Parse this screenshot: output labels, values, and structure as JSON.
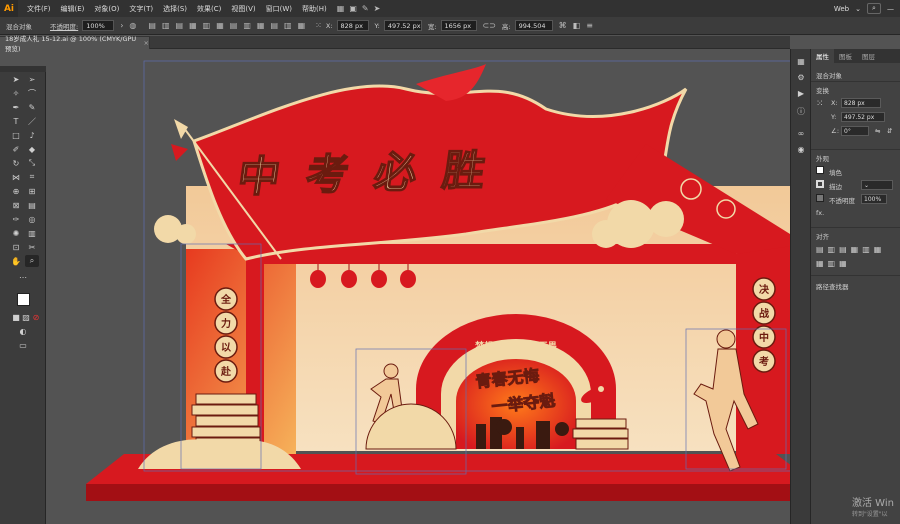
{
  "app": {
    "logo": "Ai"
  },
  "menubar": {
    "items": [
      "文件(F)",
      "编辑(E)",
      "对象(O)",
      "文字(T)",
      "选择(S)",
      "效果(C)",
      "视图(V)",
      "窗口(W)",
      "帮助(H)"
    ],
    "workspace": "Web"
  },
  "controlbar": {
    "selection_label": "混合对象",
    "opacity_label": "不透明度:",
    "opacity_value": "100%",
    "x_label": "X:",
    "x_value": "828 px",
    "y_label": "Y:",
    "y_value": "497.52 px",
    "w_label": "宽:",
    "w_value": "1656 px",
    "h_label": "高:",
    "h_value": "994.504"
  },
  "document": {
    "tab_title": "18岁成人礼 15-12.ai @ 100% (CMYK/GPU 预览)"
  },
  "artwork": {
    "banner_text": [
      "中",
      "考",
      "必",
      "胜"
    ],
    "left_pillar_text": [
      "全",
      "力",
      "以",
      "赴"
    ],
    "right_pillar_text": [
      "决",
      "战",
      "中",
      "考"
    ],
    "center_text_1": "青春无悔",
    "center_text_2": "一举夺魁",
    "arch_text": "梦想启航 · 青春无畏"
  },
  "colors": {
    "red": "#d7191f",
    "dark_red": "#a30f14",
    "cream": "#f2d9a8",
    "gold": "#e9c88a",
    "orange": "#f07a1e",
    "ui_accent": "#ff9a00"
  },
  "panel": {
    "tabs": [
      "属性",
      "图板",
      "图层"
    ],
    "selection": "混合对象",
    "transform_label": "变换",
    "x_value": "828 px",
    "y_value": "497.52 px",
    "angle_value": "0°",
    "appearance_label": "外观",
    "fill_label": "填色",
    "stroke_label": "描边",
    "opacity_label": "不透明度",
    "opacity_value": "100%",
    "fx_label": "fx.",
    "align_label": "对齐",
    "pathfinder_label": "路径查找器"
  },
  "watermark": {
    "line1": "激活 Win",
    "line2": "转到\"设置\"以"
  }
}
